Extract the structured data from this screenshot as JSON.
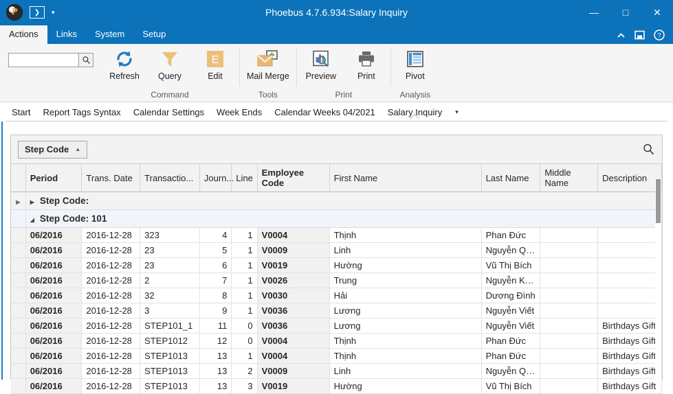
{
  "window": {
    "title": "Phoebus 4.7.6.934:Salary Inquiry",
    "logo_glyph": "P",
    "quick_access": {
      "btn_glyph": "❯",
      "dropdown_glyph": "▾"
    },
    "controls": {
      "minimize": "—",
      "maximize": "□",
      "close": "✕"
    }
  },
  "ribbon": {
    "tabs": [
      {
        "label": "Actions",
        "active": true
      },
      {
        "label": "Links",
        "active": false
      },
      {
        "label": "System",
        "active": false
      },
      {
        "label": "Setup",
        "active": false
      }
    ],
    "right_icons": {
      "collapse": "⌃",
      "window": "window-icon",
      "help": "?"
    },
    "search": {
      "value": "",
      "placeholder": ""
    },
    "groups": [
      {
        "label": "Command",
        "buttons": [
          {
            "label": "Refresh",
            "icon": "refresh-icon"
          },
          {
            "label": "Query",
            "icon": "filter-icon"
          },
          {
            "label": "Edit",
            "icon": "edit-icon",
            "icon_glyph": "E"
          }
        ]
      },
      {
        "label": "Tools",
        "buttons": [
          {
            "label": "Mail Merge",
            "icon": "mail-merge-icon"
          }
        ]
      },
      {
        "label": "Print",
        "buttons": [
          {
            "label": "Preview",
            "icon": "print-preview-icon"
          },
          {
            "label": "Print",
            "icon": "printer-icon"
          }
        ]
      },
      {
        "label": "Analysis",
        "buttons": [
          {
            "label": "Pivot",
            "icon": "pivot-table-icon"
          }
        ]
      }
    ]
  },
  "document_tabs": {
    "items": [
      {
        "label": "Start",
        "active": false
      },
      {
        "label": "Report Tags Syntax",
        "active": false
      },
      {
        "label": "Calendar Settings",
        "active": false
      },
      {
        "label": "Week Ends",
        "active": false
      },
      {
        "label": "Calendar Weeks 04/2021",
        "active": false
      },
      {
        "label": "Salary Inquiry",
        "active": true
      }
    ],
    "overflow_glyph": "▾"
  },
  "grid": {
    "group_chip": {
      "label": "Step Code",
      "sort_glyph": "▲"
    },
    "search_icon": "search-icon",
    "columns": [
      {
        "label": "Period",
        "bold": true
      },
      {
        "label": "Trans. Date",
        "bold": false
      },
      {
        "label": "Transactio...",
        "bold": false
      },
      {
        "label": "Journ...",
        "bold": false
      },
      {
        "label": "Line",
        "bold": false
      },
      {
        "label": "Employee Code",
        "bold": true
      },
      {
        "label": "First Name",
        "bold": false
      },
      {
        "label": "Last Name",
        "bold": false
      },
      {
        "label": "Middle Name",
        "bold": false
      },
      {
        "label": "Description",
        "bold": false
      }
    ],
    "group_rows": [
      {
        "label": "Step Code:",
        "expanded": false,
        "glyph": "▶",
        "selected": false,
        "indicator": "▶"
      },
      {
        "label": "Step Code: 101",
        "expanded": true,
        "glyph": "◢",
        "selected": true,
        "indicator": ""
      }
    ],
    "rows": [
      {
        "period": "06/2016",
        "trans_date": "2016-12-28",
        "transaction": "323",
        "journal": "4",
        "line": "1",
        "employee_code": "V0004",
        "first_name": "Thịnh",
        "last_name": "Phan Đức",
        "middle_name": "",
        "description": ""
      },
      {
        "period": "06/2016",
        "trans_date": "2016-12-28",
        "transaction": "23",
        "journal": "5",
        "line": "1",
        "employee_code": "V0009",
        "first_name": "Linh",
        "last_name": "Nguyễn Qu...",
        "middle_name": "",
        "description": ""
      },
      {
        "period": "06/2016",
        "trans_date": "2016-12-28",
        "transaction": "23",
        "journal": "6",
        "line": "1",
        "employee_code": "V0019",
        "first_name": "Hường",
        "last_name": "Vũ Thị Bích",
        "middle_name": "",
        "description": ""
      },
      {
        "period": "06/2016",
        "trans_date": "2016-12-28",
        "transaction": "2",
        "journal": "7",
        "line": "1",
        "employee_code": "V0026",
        "first_name": "Trung",
        "last_name": "Nguyễn Kiên",
        "middle_name": "",
        "description": ""
      },
      {
        "period": "06/2016",
        "trans_date": "2016-12-28",
        "transaction": "32",
        "journal": "8",
        "line": "1",
        "employee_code": "V0030",
        "first_name": "Hải",
        "last_name": "Dương Đình",
        "middle_name": "",
        "description": ""
      },
      {
        "period": "06/2016",
        "trans_date": "2016-12-28",
        "transaction": "3",
        "journal": "9",
        "line": "1",
        "employee_code": "V0036",
        "first_name": "Lương",
        "last_name": "Nguyễn Viết",
        "middle_name": "",
        "description": ""
      },
      {
        "period": "06/2016",
        "trans_date": "2016-12-28",
        "transaction": "STEP101_1",
        "journal": "11",
        "line": "0",
        "employee_code": "V0036",
        "first_name": "Lương",
        "last_name": "Nguyễn Viết",
        "middle_name": "",
        "description": "Birthdays Gift"
      },
      {
        "period": "06/2016",
        "trans_date": "2016-12-28",
        "transaction": "STEP1012",
        "journal": "12",
        "line": "0",
        "employee_code": "V0004",
        "first_name": "Thịnh",
        "last_name": "Phan Đức",
        "middle_name": "",
        "description": "Birthdays Gift"
      },
      {
        "period": "06/2016",
        "trans_date": "2016-12-28",
        "transaction": "STEP1013",
        "journal": "13",
        "line": "1",
        "employee_code": "V0004",
        "first_name": "Thịnh",
        "last_name": "Phan Đức",
        "middle_name": "",
        "description": "Birthdays Gift"
      },
      {
        "period": "06/2016",
        "trans_date": "2016-12-28",
        "transaction": "STEP1013",
        "journal": "13",
        "line": "2",
        "employee_code": "V0009",
        "first_name": "Linh",
        "last_name": "Nguyễn Qu...",
        "middle_name": "",
        "description": "Birthdays Gift"
      },
      {
        "period": "06/2016",
        "trans_date": "2016-12-28",
        "transaction": "STEP1013",
        "journal": "13",
        "line": "3",
        "employee_code": "V0019",
        "first_name": "Hường",
        "last_name": "Vũ Thị Bích",
        "middle_name": "",
        "description": "Birthdays Gift"
      }
    ]
  },
  "colors": {
    "titlebar": "#0c72b9",
    "ribbon_bg": "#f5f5f5",
    "accent_edge": "#1b7fc4",
    "readonly_cell": "#f1f1f1",
    "group_selected": "#eff5fb",
    "icon_tan": "#edc07a"
  }
}
